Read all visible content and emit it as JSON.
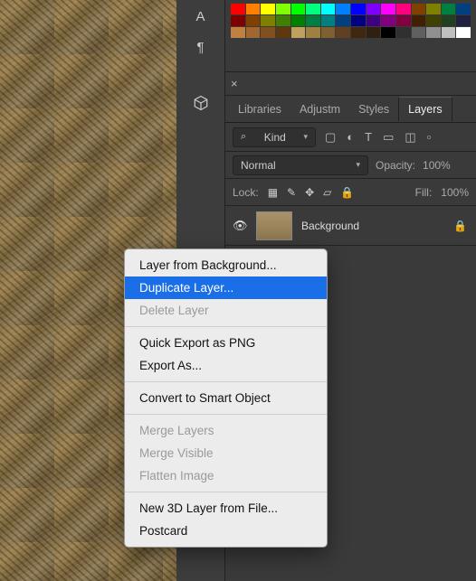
{
  "toolStrip": {
    "typeIcon": "A",
    "pilcrow": "¶",
    "cube": "⬚"
  },
  "swatches": {
    "rows": [
      [
        "#ff0000",
        "#ff7f00",
        "#ffff00",
        "#7fff00",
        "#00ff00",
        "#00ff7f",
        "#00ffff",
        "#007fff",
        "#0000ff",
        "#7f00ff",
        "#ff00ff",
        "#ff007f",
        "#804000",
        "#808000",
        "#008040",
        "#004080"
      ],
      [
        "#800000",
        "#804000",
        "#808000",
        "#408000",
        "#008000",
        "#008040",
        "#008080",
        "#004080",
        "#000080",
        "#400080",
        "#800080",
        "#800040",
        "#402000",
        "#404000",
        "#204020",
        "#202040"
      ],
      [
        "#c08040",
        "#a06830",
        "#805020",
        "#603810",
        "#c0a060",
        "#a08040",
        "#806030",
        "#604020",
        "#402810",
        "#302010",
        "#000000",
        "#303030",
        "#606060",
        "#909090",
        "#c0c0c0",
        "#ffffff"
      ]
    ]
  },
  "panelTabClose": "×",
  "tabs": [
    {
      "label": "Libraries",
      "active": false
    },
    {
      "label": "Adjustm",
      "active": false
    },
    {
      "label": "Styles",
      "active": false
    },
    {
      "label": "Layers",
      "active": true
    }
  ],
  "filter": {
    "kindLabel": "Kind",
    "icons": [
      "▢",
      "◐",
      "T",
      "▭",
      "◫",
      "▫"
    ]
  },
  "blend": {
    "mode": "Normal",
    "opacityLabel": "Opacity:",
    "opacityValue": "100%"
  },
  "lock": {
    "label": "Lock:",
    "icons": [
      "▦",
      "✎",
      "✥",
      "▱",
      "🔒"
    ],
    "fillLabel": "Fill:",
    "fillValue": "100%"
  },
  "layer": {
    "name": "Background",
    "locked": true
  },
  "contextMenu": {
    "groups": [
      [
        {
          "label": "Layer from Background...",
          "enabled": true
        },
        {
          "label": "Duplicate Layer...",
          "enabled": true,
          "hover": true
        },
        {
          "label": "Delete Layer",
          "enabled": false
        }
      ],
      [
        {
          "label": "Quick Export as PNG",
          "enabled": true
        },
        {
          "label": "Export As...",
          "enabled": true
        }
      ],
      [
        {
          "label": "Convert to Smart Object",
          "enabled": true
        }
      ],
      [
        {
          "label": "Merge Layers",
          "enabled": false
        },
        {
          "label": "Merge Visible",
          "enabled": false
        },
        {
          "label": "Flatten Image",
          "enabled": false
        }
      ],
      [
        {
          "label": "New 3D Layer from File...",
          "enabled": true
        },
        {
          "label": "Postcard",
          "enabled": true
        }
      ]
    ]
  }
}
